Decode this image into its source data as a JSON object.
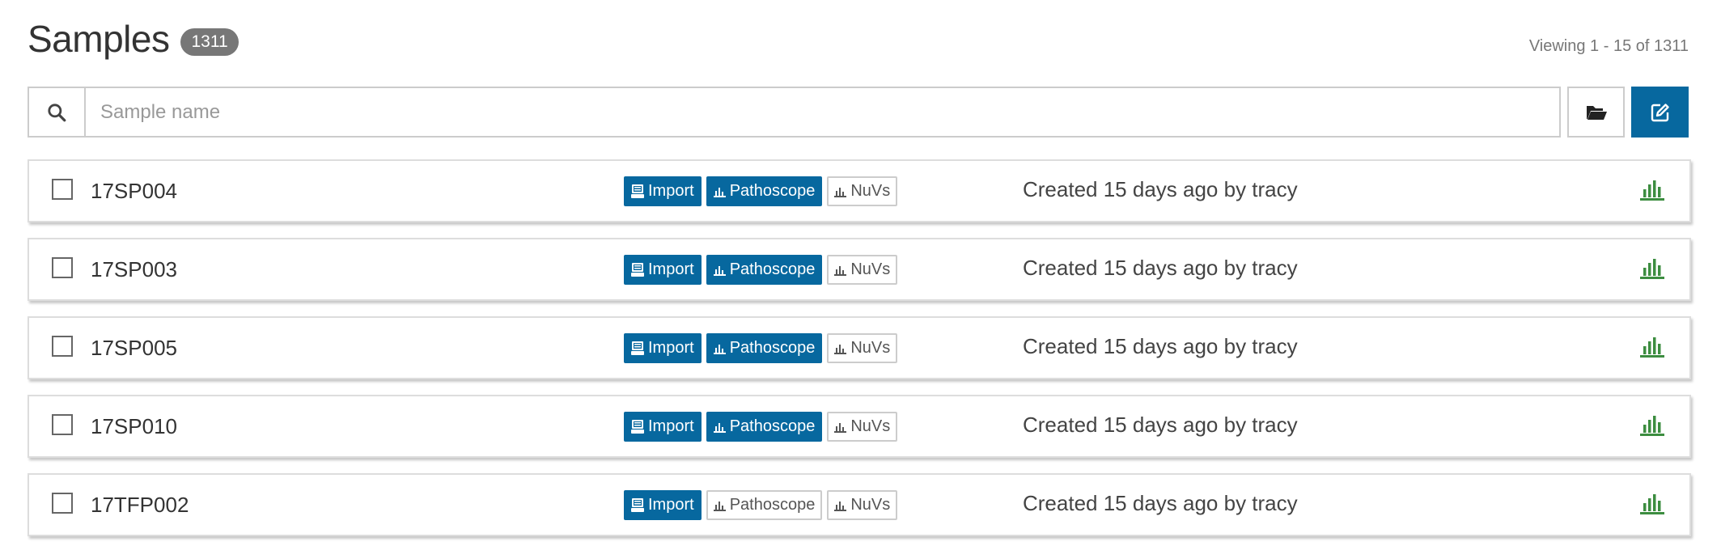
{
  "page": {
    "title": "Samples",
    "total_count": "1311",
    "viewing": "Viewing 1 - 15 of 1311"
  },
  "search": {
    "placeholder": "Sample name",
    "value": ""
  },
  "colors": {
    "primary": "#07689f",
    "analyses_icon": "#3c8d40",
    "badge": "#777777"
  },
  "icons": {
    "search": "search-icon",
    "file_manager": "folder-open-icon",
    "create": "edit-icon",
    "import_tag": "archive-icon",
    "algorithm_tag": "bar-chart-icon",
    "analyses": "bar-chart-icon"
  },
  "samples": [
    {
      "name": "17SP004",
      "tags": [
        {
          "label": "Import",
          "style": "solid",
          "icon": "archive-icon"
        },
        {
          "label": "Pathoscope",
          "style": "solid",
          "icon": "bar-chart-icon"
        },
        {
          "label": "NuVs",
          "style": "outline",
          "icon": "bar-chart-icon"
        }
      ],
      "created": "Created 15 days ago by tracy"
    },
    {
      "name": "17SP003",
      "tags": [
        {
          "label": "Import",
          "style": "solid",
          "icon": "archive-icon"
        },
        {
          "label": "Pathoscope",
          "style": "solid",
          "icon": "bar-chart-icon"
        },
        {
          "label": "NuVs",
          "style": "outline",
          "icon": "bar-chart-icon"
        }
      ],
      "created": "Created 15 days ago by tracy"
    },
    {
      "name": "17SP005",
      "tags": [
        {
          "label": "Import",
          "style": "solid",
          "icon": "archive-icon"
        },
        {
          "label": "Pathoscope",
          "style": "solid",
          "icon": "bar-chart-icon"
        },
        {
          "label": "NuVs",
          "style": "outline",
          "icon": "bar-chart-icon"
        }
      ],
      "created": "Created 15 days ago by tracy"
    },
    {
      "name": "17SP010",
      "tags": [
        {
          "label": "Import",
          "style": "solid",
          "icon": "archive-icon"
        },
        {
          "label": "Pathoscope",
          "style": "solid",
          "icon": "bar-chart-icon"
        },
        {
          "label": "NuVs",
          "style": "outline",
          "icon": "bar-chart-icon"
        }
      ],
      "created": "Created 15 days ago by tracy"
    },
    {
      "name": "17TFP002",
      "tags": [
        {
          "label": "Import",
          "style": "solid",
          "icon": "archive-icon"
        },
        {
          "label": "Pathoscope",
          "style": "outline",
          "icon": "bar-chart-icon"
        },
        {
          "label": "NuVs",
          "style": "outline",
          "icon": "bar-chart-icon"
        }
      ],
      "created": "Created 15 days ago by tracy"
    }
  ]
}
